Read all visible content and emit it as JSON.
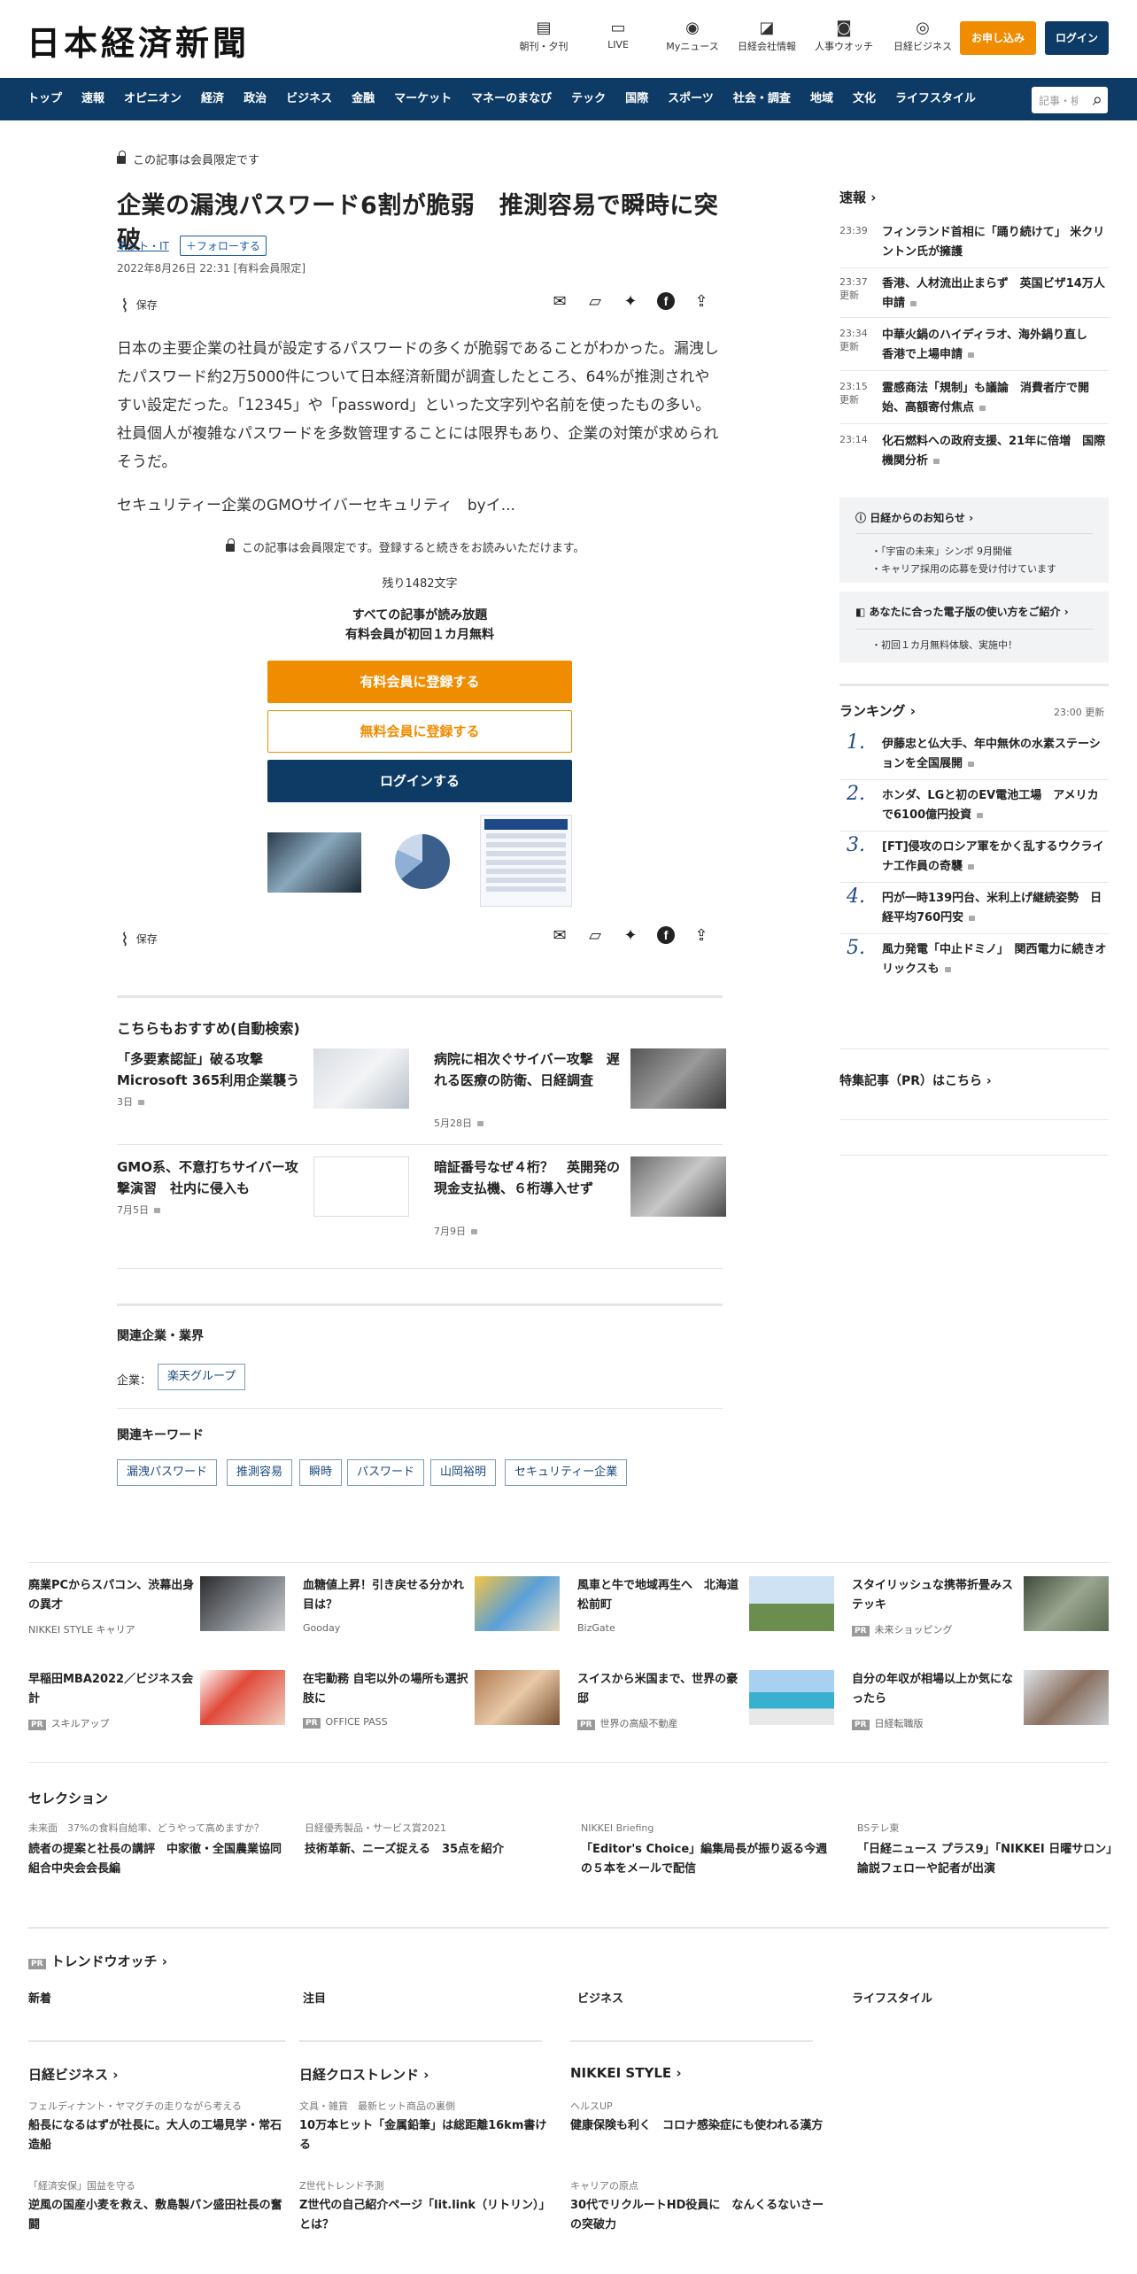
{
  "header": {
    "logo": "日本経済新聞",
    "nav_icons": [
      {
        "label": "朝刊・夕刊",
        "icon": "newspaper-icon"
      },
      {
        "label": "LIVE",
        "icon": "video-icon"
      },
      {
        "label": "Myニュース",
        "icon": "user-icon"
      },
      {
        "label": "日経会社情報",
        "icon": "chart-icon"
      },
      {
        "label": "人事ウオッチ",
        "icon": "search-icon"
      },
      {
        "label": "日経ビジネス",
        "icon": "compass-icon"
      }
    ],
    "apply_label": "お申し込み",
    "login_label": "ログイン"
  },
  "nav": {
    "items": [
      "トップ",
      "速報",
      "オピニオン",
      "経済",
      "政治",
      "ビジネス",
      "金融",
      "マーケット",
      "マネーのまなび",
      "テック",
      "国際",
      "スポーツ",
      "社会・調査",
      "地域",
      "文化",
      "ライフスタイル"
    ],
    "search_placeholder": "記事・検索"
  },
  "article": {
    "member_note": "この記事は会員限定です",
    "title": "企業の漏洩パスワード6割が脆弱　推測容易で瞬時に突破",
    "category": "ネット・IT",
    "follow_label": "フォローする",
    "date": "2022年8月26日 22:31 [有料会員限定]",
    "save_label": "保存",
    "lead": "日本の主要企業の社員が設定するパスワードの多くが脆弱であることがわかった。漏洩したパスワード約2万5000件について日本経済新聞が調査したところ、64%が推測されやすい設定だった。「12345」や「password」といった文字列や名前を使ったもの多い。社員個人が複雑なパスワードを多数管理することには限界もあり、企業の対策が求められそうだ。",
    "lead2": "セキュリティー企業のGMOサイバーセキュリティ　byイ...",
    "paywall_msg": "この記事は会員限定です。登録すると続きをお読みいただけます。",
    "remaining": "残り1482文字",
    "pitch_line1": "すべての記事が読み放題",
    "pitch_line2": "有料会員が初回１カ月無料",
    "cta_paid": "有料会員に登録する",
    "cta_free": "無料会員に登録する",
    "cta_login": "ログインする"
  },
  "recommend": {
    "heading": "こちらもおすすめ(自動検索)",
    "items": [
      {
        "title": "「多要素認証」破る攻撃　Microsoft 365利用企業襲う",
        "date": "3日"
      },
      {
        "title": "病院に相次ぐサイバー攻撃　遅れる医療の防衛、日経調査",
        "date": "5月28日"
      },
      {
        "title": "GMO系、不意打ちサイバー攻撃演習　社内に侵入も",
        "date": "7月5日"
      },
      {
        "title": "暗証番号なぜ４桁？　英開発の現金支払機、６桁導入せず",
        "date": "7月9日"
      }
    ]
  },
  "related": {
    "companies_heading": "関連企業・業界",
    "companies_label": "企業：",
    "companies": [
      "楽天グループ"
    ],
    "keywords_heading": "関連キーワード",
    "keywords": [
      "漏洩パスワード",
      "推測容易",
      "瞬時",
      "パスワード",
      "山岡裕明",
      "セキュリティー企業"
    ]
  },
  "sidebar": {
    "breaking_heading": "速報",
    "breaking": [
      {
        "time": "23:39",
        "badge": "",
        "text": "フィンランド首相に「踊り続けて」 米クリントン氏が擁護"
      },
      {
        "time": "23:37",
        "badge": "更新",
        "text": "香港、人材流出止まらず　英国ビザ14万人申請"
      },
      {
        "time": "23:34",
        "badge": "更新",
        "text": "中華火鍋のハイディラオ、海外鍋り直し　香港で上場申請"
      },
      {
        "time": "23:15",
        "badge": "更新",
        "text": "霊感商法「規制」も議論　消費者庁で開始、高額寄付焦点"
      },
      {
        "time": "23:14",
        "badge": "",
        "text": "化石燃料への政府支援、21年に倍増　国際機関分析"
      }
    ],
    "notice_heading": "日経からのお知らせ",
    "notices": [
      "「宇宙の未来」シンポ 9月開催",
      "キャリア採用の応募を受け付けています"
    ],
    "edition_heading": "あなたに合った電子版の使い方をご紹介",
    "edition_items": [
      "初回１カ月無料体験、実施中！"
    ],
    "ranking_heading": "ランキング",
    "ranking_time": "23:00 更新",
    "ranking": [
      "伊藤忠と仏大手、年中無休の水素ステーションを全国展開",
      "ホンダ、LGと初のEV電池工場　アメリカで6100億円投資",
      "[FT]侵攻のロシア軍をかく乱するウクライナ工作員の奇襲",
      "円が一時139円台、米利上げ継続姿勢　日経平均760円安",
      "風力発電「中止ドミノ」　関西電力に続きオリックスも"
    ],
    "pr_heading": "特集記事（PR）はこちら"
  },
  "promos": [
    {
      "title": "廃業PCからスパコン、渋幕出身の異才",
      "source": "NIKKEI STYLE キャリア",
      "pr": false
    },
    {
      "title": "血糖値上昇！引き戻せる分かれ目は？",
      "source": "Gooday",
      "pr": false
    },
    {
      "title": "風車と牛で地域再生へ　北海道松前町",
      "source": "BizGate",
      "pr": false
    },
    {
      "title": "スタイリッシュな携帯折畳みステッキ",
      "source": "未来ショッピング",
      "pr": true
    },
    {
      "title": "早稲田MBA2022／ビジネス会計",
      "source": "スキルアップ",
      "pr": true
    },
    {
      "title": "在宅勤務 自宅以外の場所も選択肢に",
      "source": "OFFICE PASS",
      "pr": true
    },
    {
      "title": "スイスから米国まで、世界の豪邸",
      "source": "世界の高級不動産",
      "pr": true
    },
    {
      "title": "自分の年収が相場以上か気になったら",
      "source": "日経転職版",
      "pr": true
    }
  ],
  "selection": {
    "heading": "セレクション",
    "items": [
      {
        "kicker": "未来面　37%の食料自給率、どうやって高めますか？",
        "title": "読者の提案と社長の講評　中家徹・全国農業協同組合中央会会長編"
      },
      {
        "kicker": "日経優秀製品・サービス賞2021",
        "title": "技術革新、ニーズ捉える　35点を紹介"
      },
      {
        "kicker": "NIKKEI Briefing",
        "title": "「Editor's Choice」編集局長が振り返る今週の５本をメールで配信"
      },
      {
        "kicker": "BSテレ東",
        "title": "「日経ニュース プラス9」「NIKKEI 日曜サロン」論説フェローや記者が出演"
      }
    ]
  },
  "trend": {
    "heading": "トレンドウオッチ",
    "columns": [
      "新着",
      "注目",
      "ビジネス",
      "ライフスタイル"
    ]
  },
  "bottom": {
    "columns": [
      {
        "heading": "日経ビジネス",
        "items": [
          {
            "kicker": "フェルディナント・ヤマグチの走りながら考える",
            "title": "船長になるはずが社長に。大人の工場見学・常石造船"
          },
          {
            "kicker": "「経済安保」国益を守る",
            "title": "逆風の国産小麦を救え、敷島製パン盛田社長の奮闘"
          }
        ]
      },
      {
        "heading": "日経クロストレンド",
        "items": [
          {
            "kicker": "文具・雑貨　最新ヒット商品の裏側",
            "title": "10万本ヒット「金属鉛筆」は総距離16km書ける"
          },
          {
            "kicker": "Z世代トレンド予測",
            "title": "Z世代の自己紹介ページ「lit.link（リトリン）」とは？"
          }
        ]
      },
      {
        "heading": "NIKKEI STYLE",
        "items": [
          {
            "kicker": "ヘルスUP",
            "title": "健康保険も利く　コロナ感染症にも使われる漢方"
          },
          {
            "kicker": "キャリアの原点",
            "title": "30代でリクルートHD役員に　なんくるないさーの突破力"
          }
        ]
      }
    ]
  }
}
